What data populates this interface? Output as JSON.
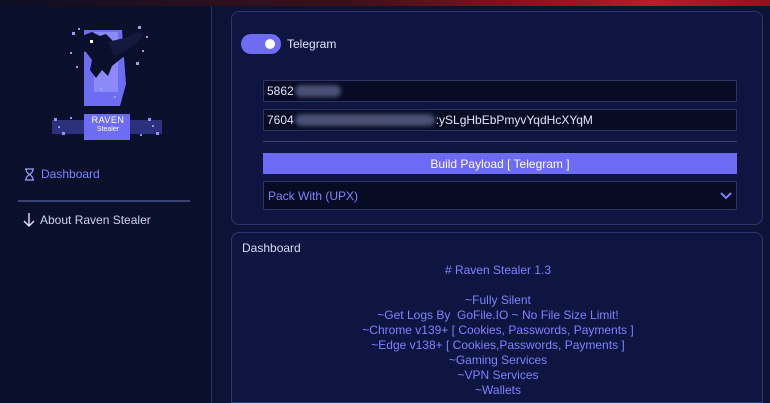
{
  "sidebar": {
    "logo_title": "RAVEN",
    "logo_subtitle": "Stealer",
    "nav": {
      "dashboard": "Dashboard",
      "about": "About Raven Stealer"
    },
    "icons": {
      "dashboard": "hourglass-icon",
      "about": "arrow-down-icon"
    }
  },
  "builder": {
    "toggle_label": "Telegram",
    "toggle_on": true,
    "chat_id_visible": "5862",
    "token_prefix_visible": "7604",
    "token_suffix_visible": ":ySLgHbEbPmyvYqdHcXYqM",
    "build_button": "Build Payload [ Telegram ]",
    "pack_select": "Pack With (UPX)"
  },
  "dashboard": {
    "title": "Dashboard",
    "lines": [
      "# Raven Stealer 1.3",
      "",
      "~Fully Silent",
      "~Get Logs By  GoFile.IO ~ No File Size Limit!",
      "~Chrome v139+ [ Cookies, Passwords, Payments ]",
      "~Edge v138+ [ Cookies,Passwords, Payments ]",
      "~Gaming Services",
      "~VPN Services",
      "~Wallets"
    ]
  },
  "colors": {
    "accent": "#6d6bf5",
    "link": "#7d83ff",
    "background": "#0b1030",
    "panel": "#0e1540"
  }
}
